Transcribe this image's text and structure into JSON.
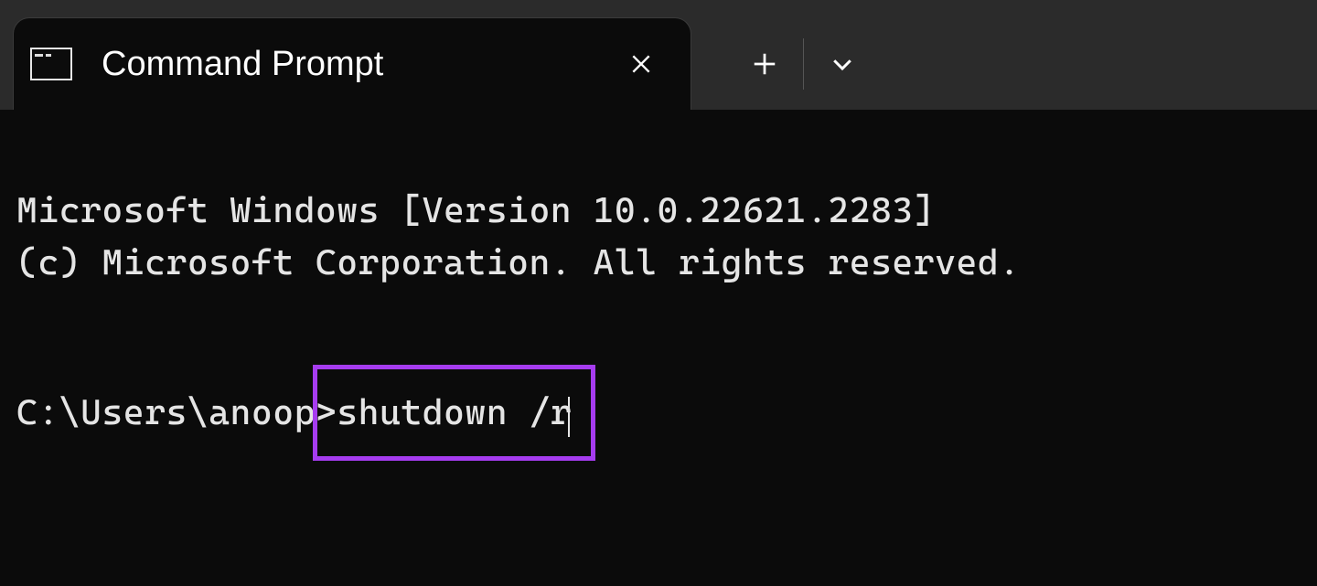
{
  "tab": {
    "title": "Command Prompt",
    "icon": "cmd-icon"
  },
  "terminal": {
    "banner_line_1": "Microsoft Windows [Version 10.0.22621.2283]",
    "banner_line_2": "(c) Microsoft Corporation. All rights reserved.",
    "prompt": "C:\\Users\\anoop>",
    "command": "shutdown /r"
  },
  "colors": {
    "highlight_border": "#a63cf0",
    "terminal_bg": "#0b0b0b",
    "titlebar_bg": "#2b2b2b",
    "text": "#e5e5e5"
  },
  "icons": {
    "close": "close-icon",
    "new_tab": "plus-icon",
    "dropdown": "chevron-down-icon"
  }
}
